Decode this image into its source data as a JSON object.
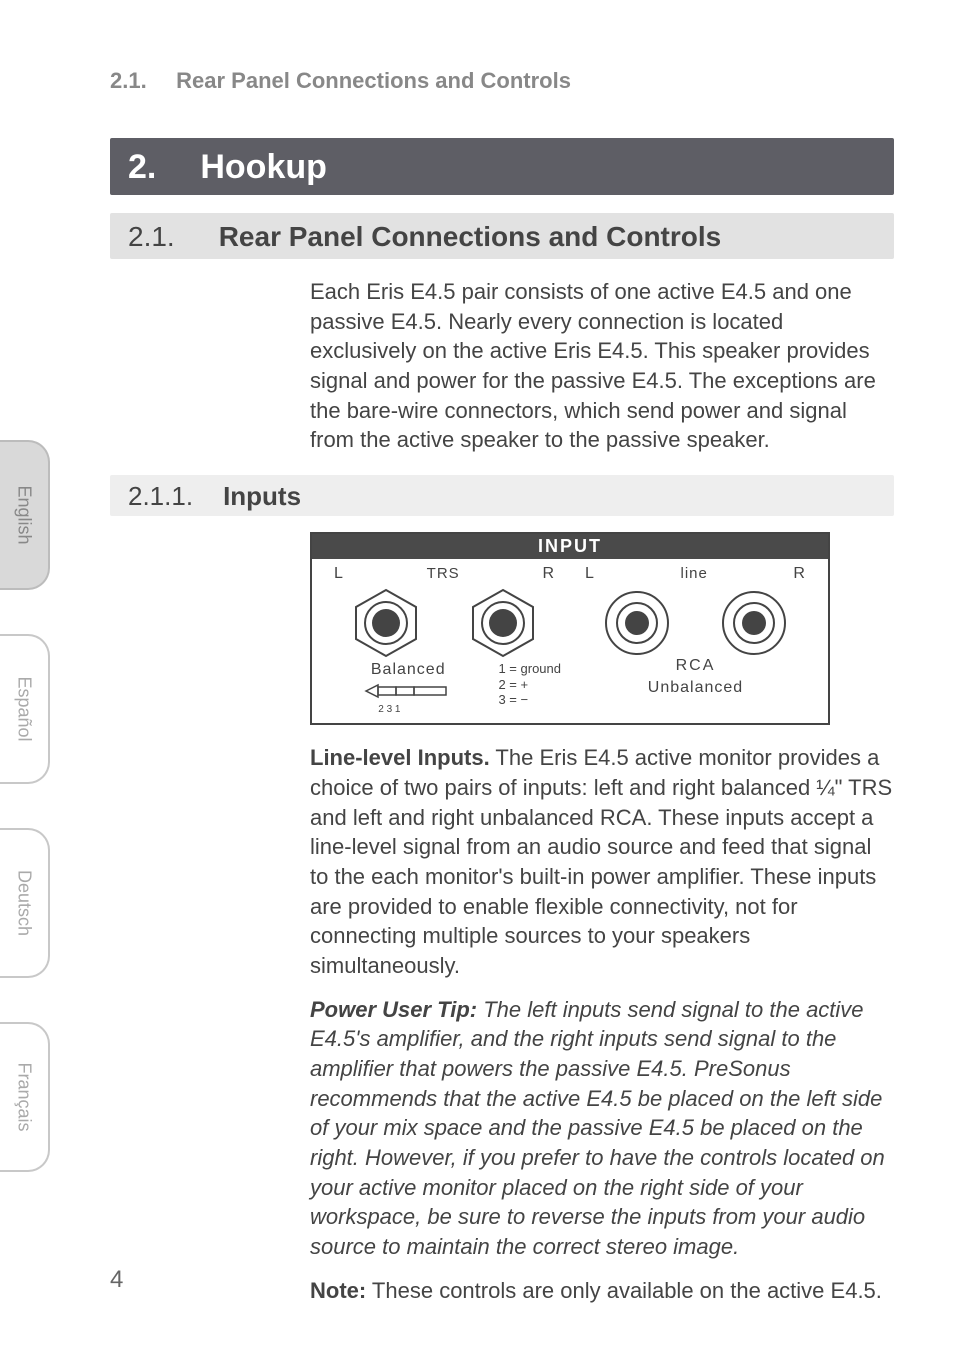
{
  "breadcrumb": {
    "num": "2.1.",
    "title": "Rear Panel Connections and Controls"
  },
  "h1": {
    "num": "2.",
    "title": "Hookup"
  },
  "h2": {
    "num": "2.1.",
    "title": "Rear Panel Connections and Controls"
  },
  "h2_body": "Each Eris E4.5 pair consists of one active E4.5 and one passive E4.5. Nearly every connection is located exclusively on the active Eris E4.5. This speaker provides signal and power for the passive E4.5. The exceptions are the bare-wire connectors, which send power and signal from the active speaker to the passive speaker.",
  "h3": {
    "num": "2.1.1.",
    "title": "Inputs"
  },
  "diagram": {
    "header": "INPUT",
    "trs": {
      "left": "L",
      "mid": "TRS",
      "right": "R",
      "bottom": "Balanced"
    },
    "rca": {
      "left": "L",
      "mid": "line",
      "right": "R",
      "top": "RCA",
      "bottom": "Unbalanced"
    },
    "pin_legend": {
      "l1": "1  =  ground",
      "l2": "2  =  +",
      "l3": "3  =  −"
    },
    "pin_nums": "2 3     1"
  },
  "para_line_level_lead": "Line-level Inputs.",
  "para_line_level": " The Eris E4.5 active monitor provides a choice of two pairs of inputs: left and right balanced ¼\" TRS and left and right unbalanced RCA. These inputs accept a line-level signal from an audio source and feed that signal to the each monitor's built-in power amplifier. These inputs are provided to enable flexible connectivity, not for connecting multiple sources to your speakers simultaneously.",
  "para_power_tip_lead": "Power User Tip:",
  "para_power_tip": " The left inputs send signal to the active E4.5's amplifier, and the right inputs send signal to the amplifier that powers the passive E4.5. PreSonus recommends that the active E4.5 be placed on the left side of your mix space and the passive E4.5 be placed on the right. However, if you prefer to have the controls located on your active monitor placed on the right side of your workspace, be sure to reverse the inputs from your audio source to maintain the correct stereo image.",
  "para_note_lead": "Note:",
  "para_note": " These controls are only available on the active E4.5.",
  "tabs": {
    "english": "English",
    "espanol": "Español",
    "deutsch": "Deutsch",
    "francais": "Français"
  },
  "page_number": "4"
}
